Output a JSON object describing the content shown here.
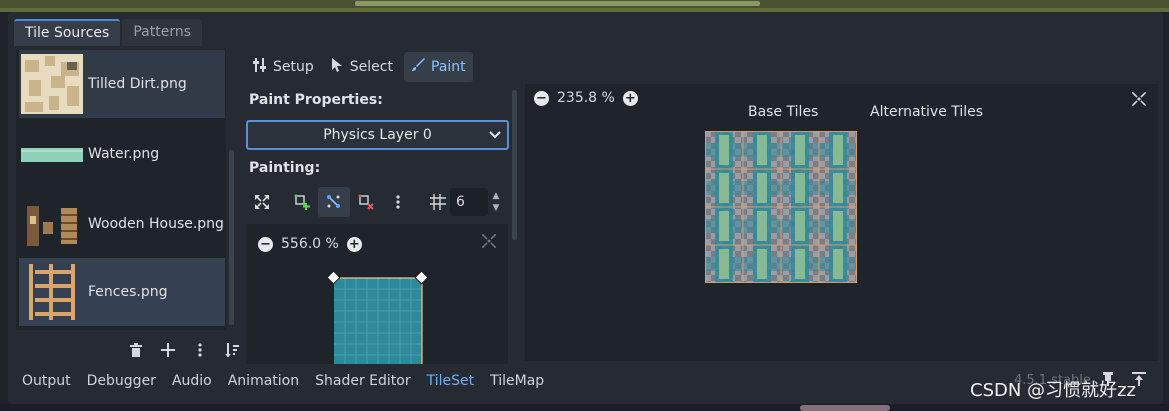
{
  "tabs": [
    {
      "label": "Tile Sources",
      "active": true
    },
    {
      "label": "Patterns",
      "active": false
    }
  ],
  "sources": [
    {
      "label": "Tilled Dirt.png",
      "thumb": "tilled-dirt"
    },
    {
      "label": "Water.png",
      "thumb": "water"
    },
    {
      "label": "Wooden House.png",
      "thumb": "wooden-house"
    },
    {
      "label": "Fences.png",
      "thumb": "fences",
      "selected": true
    }
  ],
  "source_actions": [
    "trash-icon",
    "plus-icon",
    "kebab-icon",
    "sort-icon"
  ],
  "toolbar": {
    "setup": "Setup",
    "select": "Select",
    "paint": "Paint"
  },
  "props": {
    "paint_properties_title": "Paint Properties:",
    "layer_selected": "Physics Layer 0",
    "painting_title": "Painting:",
    "grid_value": "6"
  },
  "mini_view": {
    "zoom": "556.0 %"
  },
  "main_view": {
    "zoom": "235.8 %",
    "base_tiles": "Base Tiles",
    "alt_tiles": "Alternative Tiles"
  },
  "bottom_tabs": [
    {
      "label": "Output",
      "active": false
    },
    {
      "label": "Debugger",
      "active": false
    },
    {
      "label": "Audio",
      "active": false
    },
    {
      "label": "Animation",
      "active": false
    },
    {
      "label": "Shader Editor",
      "active": false
    },
    {
      "label": "TileSet",
      "active": true
    },
    {
      "label": "TileMap",
      "active": false
    }
  ],
  "version": "4.5.1.stable",
  "watermark": "CSDN @习惯就好zz",
  "colors": {
    "accent": "#4d8bd6",
    "active_text": "#72aef5",
    "tile_teal": "#2e8a9a"
  }
}
